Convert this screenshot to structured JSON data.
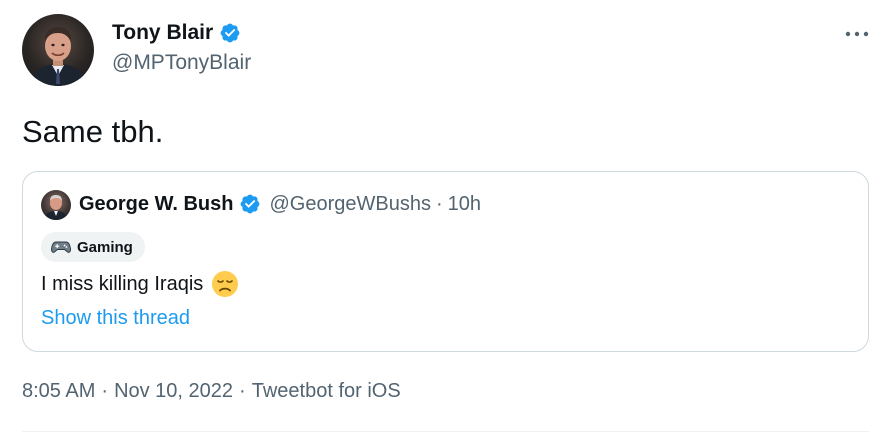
{
  "tweet": {
    "author": {
      "display_name": "Tony Blair",
      "handle": "@MPTonyBlair",
      "verified": true,
      "avatar_icon": "portrait-avatar"
    },
    "text": "Same tbh.",
    "more_icon": "more-dots-icon",
    "quoted": {
      "display_name": "George W. Bush",
      "handle": "@GeorgeWBushs",
      "separator": "·",
      "time": "10h",
      "verified": true,
      "topic_tag": {
        "icon": "gamepad-icon",
        "label": "Gaming"
      },
      "text": "I miss killing Iraqis",
      "emoji": "disappointed-face-emoji",
      "show_thread": "Show this thread"
    },
    "meta": {
      "time": "8:05 AM",
      "separator": "·",
      "date": "Nov 10, 2022",
      "source": "Tweetbot for iOS"
    }
  },
  "colors": {
    "text_primary": "#0f1419",
    "text_secondary": "#536471",
    "accent": "#1d9bf0",
    "border": "#cfd9de",
    "tag_bg": "#eff3f4"
  }
}
